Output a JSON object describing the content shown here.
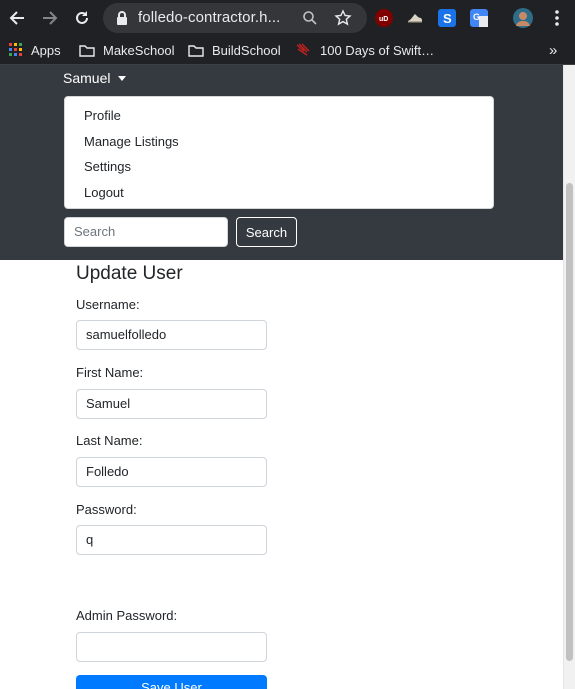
{
  "browser": {
    "url": "folledo-contractor.h...",
    "bookmarks": [
      {
        "label": "Apps",
        "icon": "apps-grid-icon"
      },
      {
        "label": "MakeSchool",
        "icon": "folder-icon"
      },
      {
        "label": "BuildSchool",
        "icon": "folder-icon"
      },
      {
        "label": "100 Days of Swift…",
        "icon": "swift-icon"
      }
    ],
    "overflow": "»",
    "extensions": [
      "ublock-icon",
      "sneaker-icon",
      "s-extension-icon",
      "translate-icon",
      "profile-avatar-icon"
    ]
  },
  "navbar": {
    "user_menu": "Samuel",
    "dropdown_items": [
      "Profile",
      "Manage Listings",
      "Settings",
      "Logout"
    ],
    "search_placeholder": "Search",
    "search_button": "Search"
  },
  "form": {
    "title": "Update User",
    "fields": [
      {
        "label": "Username:",
        "value": "samuelfolledo"
      },
      {
        "label": "First Name:",
        "value": "Samuel"
      },
      {
        "label": "Last Name:",
        "value": "Folledo"
      },
      {
        "label": "Password:",
        "value": "q"
      },
      {
        "label": "Admin Password:",
        "value": ""
      }
    ],
    "submit": "Save User"
  },
  "colors": {
    "navbar": "#343a40",
    "primary": "#007bff",
    "chrome": "#202124"
  }
}
